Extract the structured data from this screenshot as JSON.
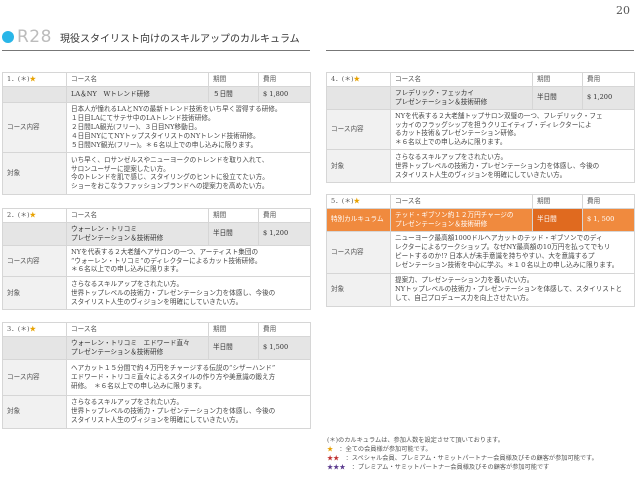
{
  "page": {
    "number": "20"
  },
  "header": {
    "code": "R28",
    "title": "現役スタイリスト向けのスキルアップのカルキュラム"
  },
  "columns": {
    "course_name": "コース名",
    "period": "期間",
    "fee": "費用",
    "content": "コース内容",
    "target": "対象"
  },
  "courses": [
    {
      "no": "1．(＊)",
      "star": "★",
      "name": "LA＆NY　Wトレンド研修",
      "period": "５日間",
      "fee": "$ 1,800",
      "content": "日本人が憧れるLAとNYの最新トレンド技術をいち早く習得する研修。\n１日目LAにてサテサ中のLAトレンド技術研修。\n２日間LA観光(フリー)、３日目NY移動日。\n４日目NYにてNYトップスタイリストのNYトレンド技術研修。\n５日間NY観光(フリー)。＊６名以上での申し込みに限ります。",
      "target": "いち早く、ロサンゼルスやニューヨークのトレンドを取り入れて、\nサロンユーザーに提案したい方。\n今のトレンドを肌で感じ、スタイリングのヒントに役立てたい方。\nショーをおこなうファッションブランドへの提案力を高めたい方。"
    },
    {
      "no": "2．(＊)",
      "star": "★",
      "name": "ウォーレン・トリコミ\nプレゼンテーション＆技術研修",
      "period": "半日間",
      "fee": "$ 1,200",
      "content": "NYを代表する２大老舗ヘアサロンの一つ、アーティスト集団の\n“ウォーレン・トリコミ”のディレクターによるカット技術研修。\n＊６名以上での申し込みに限ります。",
      "target": "さらなるスキルアップをされたい方。\n世界トップレベルの技術力・プレゼンテーション力を体感し、今後の\nスタイリスト人生のヴィジョンを明確にしていきたい方。"
    },
    {
      "no": "3．(＊)",
      "star": "★",
      "name": "ウォーレン・トリコミ　エドワード直々\nプレゼンテーション＆技術研修",
      "period": "半日間",
      "fee": "$ 1,500",
      "content": "ヘアカット１５分間で約４万円をチャージする伝説の“シザーハンド”\nエドワード・トリコミ直々によるスタイルの作り方や美意識の鍛え方\n研修。　＊６名以上での申し込みに限ります。",
      "target": "さらなるスキルアップをされたい方。\n世界トップレベルの技術力・プレゼンテーション力を体感し、今後の\nスタイリスト人生のヴィジョンを明確にしていきたい方。"
    },
    {
      "no": "4．(＊)",
      "star": "★",
      "name": "フレデリック・フェッカイ\nプレゼンテーション＆技術研修",
      "period": "半日間",
      "fee": "$ 1,200",
      "content": "NYを代表する２大老舗トップサロン双璧の一つ、フレデリック・フェ\nッカイのフラッグシップを担うクリエイティブ・ディレクターによ\nるカット技術＆プレゼンテーション研修。\n＊６名以上での申し込みに限ります。",
      "target": "さらなるスキルアップをされたい方。\n世界トップレベルの技術力・プレゼンテーション力を体感し、今後の\nスタイリスト人生のヴィジョンを明確にしていきたい方。"
    },
    {
      "no": "5．(＊)",
      "star": "★",
      "badge": "特別カルキュラム",
      "name": "テッド・ギブソン約１２万円チャージの\nプレゼンテーション＆技術研修",
      "period": "半日間",
      "fee": "$ 1, 500",
      "content": "ニューヨーク最高額1000ドルヘアカットのテッド・ギブソンでのディ\nレクターによるワークショップ。なぜNY最高額の10万円を払ってでもリ\nピートするのか!? 日本人が未手意識を持ちやすい、大を意識するプ\nレゼンテーション技術を中心に学ぶ。＊１０名以上の申し込みに限ります。",
      "target": "提案力、プレゼンテーション力を養いたい方。\nNYトップレベルの技術力・プレゼンテーションを体感して、スタイリストと\nして、自己プロデュース力を向上させたい方。"
    }
  ],
  "notes": {
    "intro": "(＊)のカルキュラムは、参加人数を設定させて頂いております。",
    "tiers": [
      {
        "stars": "★",
        "text": "：全ての会員様が参加可能です。"
      },
      {
        "stars": "★★",
        "text": "：スペシャル会員、プレミアム・サミットパートナー会員様及びその顧客が参加可能です。"
      },
      {
        "stars": "★★★",
        "text": "：プレミアム・サミットパートナー会員様及びその顧客が参加可能です"
      }
    ]
  },
  "colors": {
    "accent": "#29b6e8",
    "highlight": "#f08a3e",
    "star": "#e8a200"
  }
}
